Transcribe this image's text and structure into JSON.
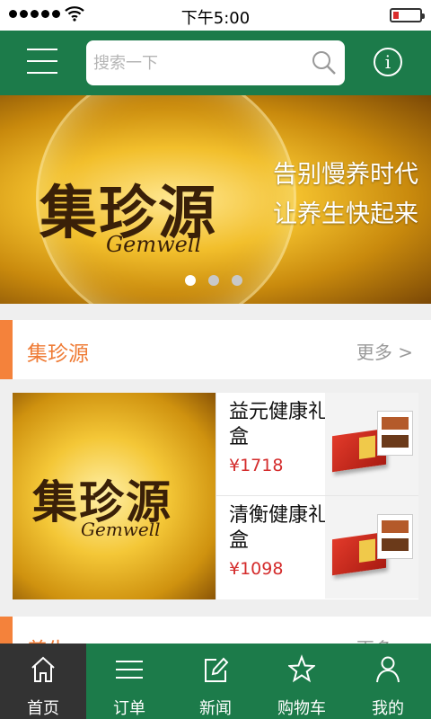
{
  "status_bar": {
    "time": "下午5:00"
  },
  "header": {
    "search_placeholder": "搜索一下"
  },
  "banner": {
    "brand_cn": "集珍源",
    "brand_en": "Gemwell",
    "slogan_line1": "告别慢养时代",
    "slogan_line2": "让养生快起来",
    "page_count": 3,
    "active_page": 1
  },
  "section1": {
    "title": "集珍源",
    "more": "更多 >"
  },
  "promo": {
    "brand_cn": "集珍源",
    "brand_en": "Gemwell"
  },
  "products": [
    {
      "name": "益元健康礼盒",
      "price": "¥1718"
    },
    {
      "name": "清衡健康礼盒",
      "price": "¥1098"
    }
  ],
  "section2": {
    "title": "养生",
    "more": "更多 >"
  },
  "tabs": [
    {
      "label": "首页",
      "icon": "home-icon",
      "active": true
    },
    {
      "label": "订单",
      "icon": "list-icon",
      "active": false
    },
    {
      "label": "新闻",
      "icon": "edit-icon",
      "active": false
    },
    {
      "label": "购物车",
      "icon": "star-icon",
      "active": false
    },
    {
      "label": "我的",
      "icon": "user-icon",
      "active": false
    }
  ],
  "colors": {
    "primary_green": "#1c7b4a",
    "accent_orange": "#f4823b",
    "price_red": "#d42c2c",
    "active_tab": "#333333"
  }
}
